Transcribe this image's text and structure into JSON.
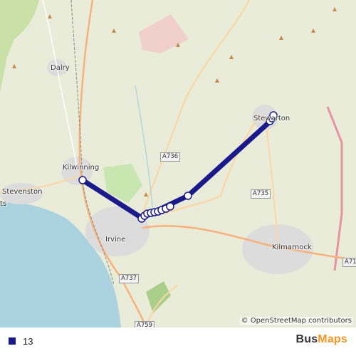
{
  "map": {
    "places": [
      {
        "name": "Dalry",
        "id": "place-dalry"
      },
      {
        "name": "Kilwinning",
        "id": "place-kilwinning"
      },
      {
        "name": "Stevenston",
        "id": "place-stevenston"
      },
      {
        "name": "Irvine",
        "id": "place-irvine"
      },
      {
        "name": "Stewarton",
        "id": "place-stewarton"
      },
      {
        "name": "Kilmarnock",
        "id": "place-kilmarnock"
      },
      {
        "name": "ts",
        "id": "place-ts"
      }
    ],
    "roads": [
      "A736",
      "A735",
      "A737",
      "A759",
      "A71"
    ],
    "attribution": "© OpenStreetMap contributors"
  },
  "route": {
    "line_color": "#1a1a8c",
    "stop_fill": "#ffffff"
  },
  "legend": {
    "route_number": "13",
    "swatch_color": "#1a1a8c"
  },
  "brand": {
    "part1": "Bus",
    "part2": "Maps"
  }
}
